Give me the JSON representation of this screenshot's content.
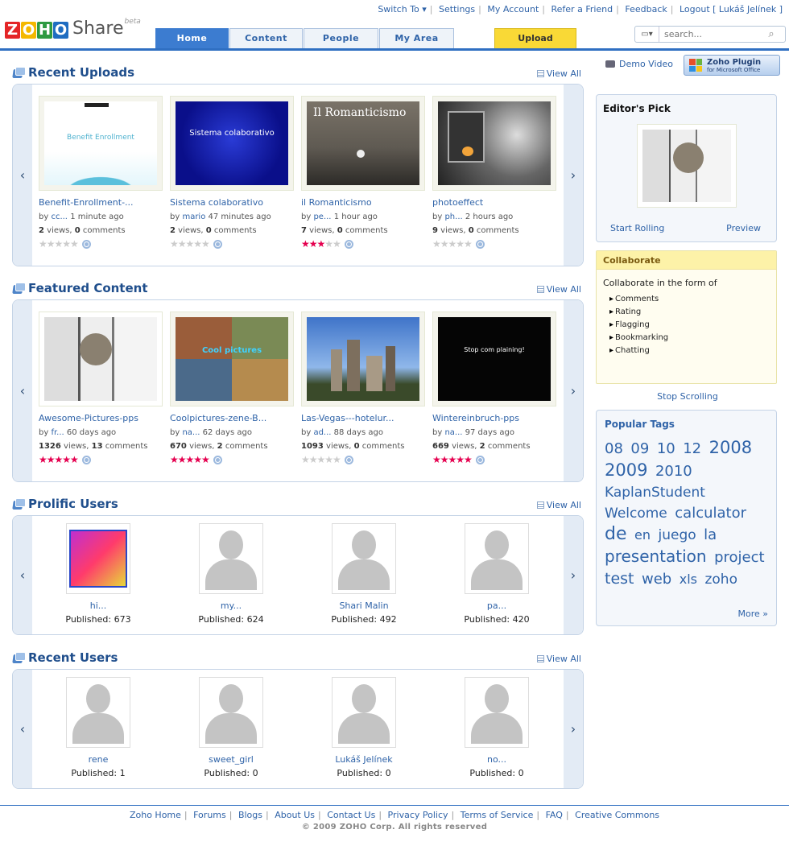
{
  "brand": {
    "letters": [
      "Z",
      "O",
      "H",
      "O"
    ],
    "product": "Share",
    "beta": "beta"
  },
  "toplinks": [
    "Switch To ▾",
    "Settings",
    "My Account",
    "Refer a Friend",
    "Feedback",
    "Logout [ Lukáš Jelínek ]"
  ],
  "tabs": [
    {
      "label": "Home",
      "active": true
    },
    {
      "label": "Content"
    },
    {
      "label": "People"
    },
    {
      "label": "My Area"
    }
  ],
  "upload_label": "Upload",
  "search": {
    "placeholder": "search..."
  },
  "sections": {
    "recent_uploads": {
      "title": "Recent Uploads",
      "view_all": "View All"
    },
    "featured": {
      "title": "Featured Content",
      "view_all": "View All"
    },
    "prolific": {
      "title": "Prolific Users",
      "view_all": "View All"
    },
    "recent_users": {
      "title": "Recent Users",
      "view_all": "View All"
    }
  },
  "recent_uploads": [
    {
      "title": "Benefit-Enrollment-...",
      "by": "cc...",
      "ago": "1 minute ago",
      "views": "2",
      "comments": "0",
      "stars": 0
    },
    {
      "title": "Sistema colaborativo",
      "by": "mario",
      "ago": "47 minutes ago",
      "views": "2",
      "comments": "0",
      "stars": 0
    },
    {
      "title": "il Romanticismo",
      "by": "pe...",
      "ago": "1 hour ago",
      "views": "7",
      "comments": "0",
      "stars": 3
    },
    {
      "title": "photoeffect",
      "by": "ph...",
      "ago": "2 hours ago",
      "views": "9",
      "comments": "0",
      "stars": 0
    }
  ],
  "thumb_text": {
    "benefit_brand": "Benefit Enrollment",
    "sistema": "Sistema colaborativo",
    "romanticismo": "Il Romanticismo",
    "stop": "Stop com plaining!",
    "coolpics": "Cool pictures"
  },
  "featured": [
    {
      "title": "Awesome-Pictures-pps",
      "by": "fr...",
      "ago": "60 days ago",
      "views": "1326",
      "comments": "13",
      "stars": 5
    },
    {
      "title": "Coolpictures-zene-B...",
      "by": "na...",
      "ago": "62 days ago",
      "views": "670",
      "comments": "2",
      "stars": 5
    },
    {
      "title": "Las-Vegas---hotelur...",
      "by": "ad...",
      "ago": "88 days ago",
      "views": "1093",
      "comments": "0",
      "stars": 0
    },
    {
      "title": "Wintereinbruch-pps",
      "by": "na...",
      "ago": "97 days ago",
      "views": "669",
      "comments": "2",
      "stars": 5
    }
  ],
  "labels": {
    "by": "by",
    "views": "views,",
    "comments": "comments",
    "published": "Published:"
  },
  "prolific": [
    {
      "name": "hi...",
      "published": "673"
    },
    {
      "name": "my...",
      "published": "624"
    },
    {
      "name": "Shari Malin",
      "published": "492"
    },
    {
      "name": "pa...",
      "published": "420"
    }
  ],
  "recent_users": [
    {
      "name": "rene",
      "published": "1"
    },
    {
      "name": "sweet_girl",
      "published": "0"
    },
    {
      "name": "Lukáš Jelínek",
      "published": "0"
    },
    {
      "name": "no...",
      "published": "0"
    }
  ],
  "sidebar": {
    "demo": "Demo Video",
    "plugin_1": "Zoho Plugin",
    "plugin_2": "for Microsoft Office",
    "editors_pick": "Editor's Pick",
    "start_rolling": "Start Rolling",
    "preview": "Preview",
    "collab_title": "Collaborate",
    "collab_intro": "Collaborate in the form of",
    "collab_items": [
      "Comments",
      "Rating",
      "Flagging",
      "Bookmarking",
      "Chatting"
    ],
    "stop_scrolling": "Stop Scrolling",
    "tags_title": "Popular Tags",
    "tags": [
      {
        "t": "08",
        "s": 18
      },
      {
        "t": "09",
        "s": 18
      },
      {
        "t": "10",
        "s": 18
      },
      {
        "t": "12",
        "s": 18
      },
      {
        "t": "2008",
        "s": 21
      },
      {
        "t": "2009",
        "s": 21
      },
      {
        "t": "2010",
        "s": 18
      },
      {
        "t": "KaplanStudent",
        "s": 17
      },
      {
        "t": "Welcome",
        "s": 17
      },
      {
        "t": "calculator",
        "s": 18
      },
      {
        "t": "de",
        "s": 22
      },
      {
        "t": "en",
        "s": 16
      },
      {
        "t": "juego",
        "s": 17
      },
      {
        "t": "la",
        "s": 18
      },
      {
        "t": "presentation",
        "s": 20
      },
      {
        "t": "project",
        "s": 18
      },
      {
        "t": "test",
        "s": 19
      },
      {
        "t": "web",
        "s": 18
      },
      {
        "t": "xls",
        "s": 16
      },
      {
        "t": "zoho",
        "s": 17
      }
    ],
    "more": "More »"
  },
  "footer": [
    "Zoho Home",
    "Forums",
    "Blogs",
    "About Us",
    "Contact Us",
    "Privacy Policy",
    "Terms of Service",
    "FAQ",
    "Creative Commons"
  ],
  "copyright": "© 2009 ZOHO Corp. All rights reserved"
}
